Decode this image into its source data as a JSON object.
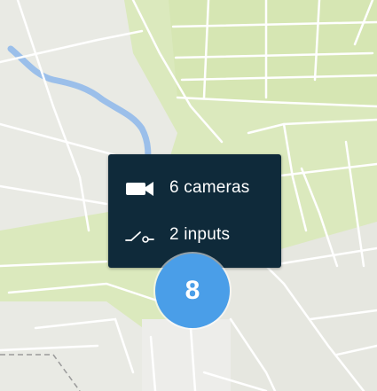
{
  "map": {
    "colors": {
      "land_green": "#dbe9bd",
      "land_grey": "#e9eae4",
      "road": "#ffffff",
      "water": "#9bbfea",
      "cluster": "#4a9ee8",
      "tooltip_bg": "#0f2a3a"
    }
  },
  "tooltip": {
    "rows": [
      {
        "icon": "camera-icon",
        "label": "6 cameras"
      },
      {
        "icon": "input-switch-icon",
        "label": "2 inputs"
      }
    ]
  },
  "cluster": {
    "count": "8"
  }
}
